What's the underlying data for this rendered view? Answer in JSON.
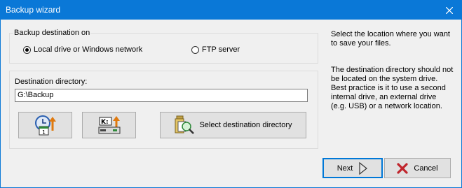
{
  "window": {
    "title": "Backup wizard"
  },
  "destination_group": {
    "legend": "Backup destination on",
    "options": [
      {
        "label": "Local drive or Windows network",
        "selected": true
      },
      {
        "label": "FTP server",
        "selected": false
      }
    ]
  },
  "directory_group": {
    "label": "Destination directory:",
    "value": "G:\\Backup",
    "select_button_label": "Select destination directory"
  },
  "help": {
    "intro": "Select the location where you want to save your files.",
    "details": "The destination directory should not be located on the system drive. Best practice is it to use a second internal drive, an external drive (e.g. USB) or a network location."
  },
  "footer": {
    "next_label": "Next",
    "cancel_label": "Cancel"
  },
  "colors": {
    "titlebar": "#0a78d7",
    "focus_border": "#0078d7",
    "cancel_icon": "#c0262d"
  }
}
